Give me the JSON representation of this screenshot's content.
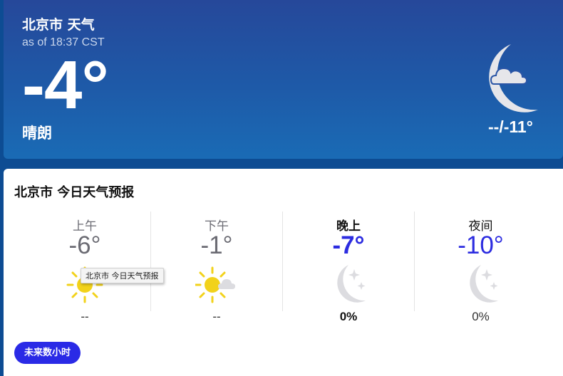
{
  "current": {
    "title": "北京市 天气",
    "as_of": "as of 18:37 CST",
    "temperature": "-4°",
    "condition": "晴朗",
    "hi_lo": "--/-11°",
    "icon": "moon-cloud-icon"
  },
  "forecast": {
    "title": "北京市 今日天气预报",
    "periods": [
      {
        "label": "上午",
        "temp": "-6°",
        "precip": "--",
        "icon": "sun-icon"
      },
      {
        "label": "下午",
        "temp": "-1°",
        "precip": "--",
        "icon": "sun-cloud-icon"
      },
      {
        "label": "晚上",
        "temp": "-7°",
        "precip": "0%",
        "icon": "moon-stars-icon"
      },
      {
        "label": "夜间",
        "temp": "-10°",
        "precip": "0%",
        "icon": "moon-stars-icon"
      }
    ],
    "tooltip": "北京市 今日天气预报",
    "hourly_button": "未来数小时"
  },
  "colors": {
    "hero_top": "#26489a",
    "hero_bottom": "#1a6bb5",
    "accent_blue": "#2c2ce0",
    "sun_yellow": "#f2d21b"
  }
}
